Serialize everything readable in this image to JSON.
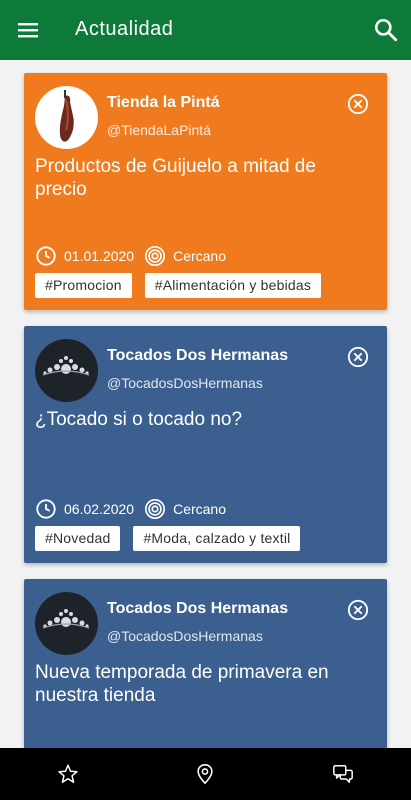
{
  "app": {
    "title": "Actualidad"
  },
  "posts": [
    {
      "store": "Tienda la Pintá",
      "handle": "@TiendaLaPintá",
      "headline": "Productos de Guijuelo a mitad de precio",
      "date": "01.01.2020",
      "distance": "Cercano",
      "tags": [
        "#Promocion",
        "#Alimentación y bebidas"
      ],
      "color": "#f07b1f"
    },
    {
      "store": "Tocados Dos Hermanas",
      "handle": "@TocadosDosHermanas",
      "headline": "¿Tocado si o tocado no?",
      "date": "06.02.2020",
      "distance": "Cercano",
      "tags": [
        "#Novedad",
        "#Moda, calzado y textil"
      ],
      "color": "#3b5f8e"
    },
    {
      "store": "Tocados Dos Hermanas",
      "handle": "@TocadosDosHermanas",
      "headline": "Nueva temporada de primavera en nuestra tienda",
      "color": "#3b5f8e"
    }
  ],
  "icons": {
    "menu": "menu-icon",
    "search": "search-icon",
    "close": "close-circle-icon",
    "clock": "clock-icon",
    "location": "target-icon",
    "favorites": "star-icon",
    "map": "map-pin-icon",
    "messages": "chat-icon"
  }
}
